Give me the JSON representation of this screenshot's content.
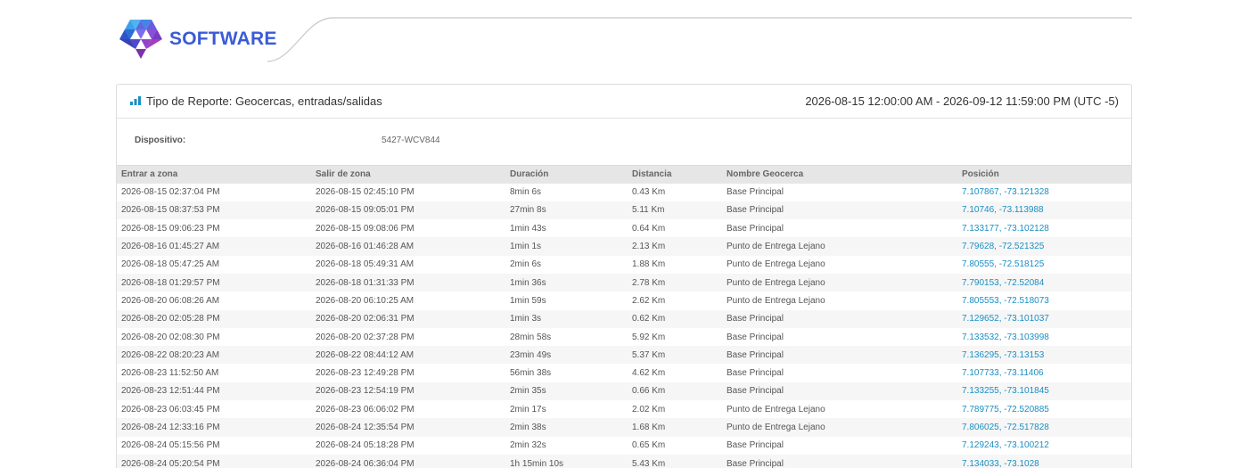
{
  "brand": {
    "name": "SOFTWARE"
  },
  "report": {
    "type_label": "Tipo de Reporte: Geocercas, entradas/salidas",
    "date_range": "2026-08-15 12:00:00 AM - 2026-09-12 11:59:00 PM (UTC -5)",
    "device_label": "Dispositivo:",
    "device_value": "5427-WCV844"
  },
  "table": {
    "headers": [
      "Entrar a zona",
      "Salir de zona",
      "Duración",
      "Distancia",
      "Nombre Geocerca",
      "Posición"
    ],
    "rows": [
      [
        "2026-08-15 02:37:04 PM",
        "2026-08-15 02:45:10 PM",
        "8min 6s",
        "0.43 Km",
        "Base Principal",
        "7.107867, -73.121328"
      ],
      [
        "2026-08-15 08:37:53 PM",
        "2026-08-15 09:05:01 PM",
        "27min 8s",
        "5.11 Km",
        "Base Principal",
        "7.10746, -73.113988"
      ],
      [
        "2026-08-15 09:06:23 PM",
        "2026-08-15 09:08:06 PM",
        "1min 43s",
        "0.64 Km",
        "Base Principal",
        "7.133177, -73.102128"
      ],
      [
        "2026-08-16 01:45:27 AM",
        "2026-08-16 01:46:28 AM",
        "1min 1s",
        "2.13 Km",
        "Punto de Entrega Lejano",
        "7.79628, -72.521325"
      ],
      [
        "2026-08-18 05:47:25 AM",
        "2026-08-18 05:49:31 AM",
        "2min 6s",
        "1.88 Km",
        "Punto de Entrega Lejano",
        "7.80555, -72.518125"
      ],
      [
        "2026-08-18 01:29:57 PM",
        "2026-08-18 01:31:33 PM",
        "1min 36s",
        "2.78 Km",
        "Punto de Entrega Lejano",
        "7.790153, -72.52084"
      ],
      [
        "2026-08-20 06:08:26 AM",
        "2026-08-20 06:10:25 AM",
        "1min 59s",
        "2.62 Km",
        "Punto de Entrega Lejano",
        "7.805553, -72.518073"
      ],
      [
        "2026-08-20 02:05:28 PM",
        "2026-08-20 02:06:31 PM",
        "1min 3s",
        "0.62 Km",
        "Base Principal",
        "7.129652, -73.101037"
      ],
      [
        "2026-08-20 02:08:30 PM",
        "2026-08-20 02:37:28 PM",
        "28min 58s",
        "5.92 Km",
        "Base Principal",
        "7.133532, -73.103998"
      ],
      [
        "2026-08-22 08:20:23 AM",
        "2026-08-22 08:44:12 AM",
        "23min 49s",
        "5.37 Km",
        "Base Principal",
        "7.136295, -73.13153"
      ],
      [
        "2026-08-23 11:52:50 AM",
        "2026-08-23 12:49:28 PM",
        "56min 38s",
        "4.62 Km",
        "Base Principal",
        "7.107733, -73.11406"
      ],
      [
        "2026-08-23 12:51:44 PM",
        "2026-08-23 12:54:19 PM",
        "2min 35s",
        "0.66 Km",
        "Base Principal",
        "7.133255, -73.101845"
      ],
      [
        "2026-08-23 06:03:45 PM",
        "2026-08-23 06:06:02 PM",
        "2min 17s",
        "2.02 Km",
        "Punto de Entrega Lejano",
        "7.789775, -72.520885"
      ],
      [
        "2026-08-24 12:33:16 PM",
        "2026-08-24 12:35:54 PM",
        "2min 38s",
        "1.68 Km",
        "Punto de Entrega Lejano",
        "7.806025, -72.517828"
      ],
      [
        "2026-08-24 05:15:56 PM",
        "2026-08-24 05:18:28 PM",
        "2min 32s",
        "0.65 Km",
        "Base Principal",
        "7.129243, -73.100212"
      ],
      [
        "2026-08-24 05:20:54 PM",
        "2026-08-24 06:36:04 PM",
        "1h 15min 10s",
        "5.43 Km",
        "Base Principal",
        "7.134033, -73.1028"
      ]
    ]
  }
}
